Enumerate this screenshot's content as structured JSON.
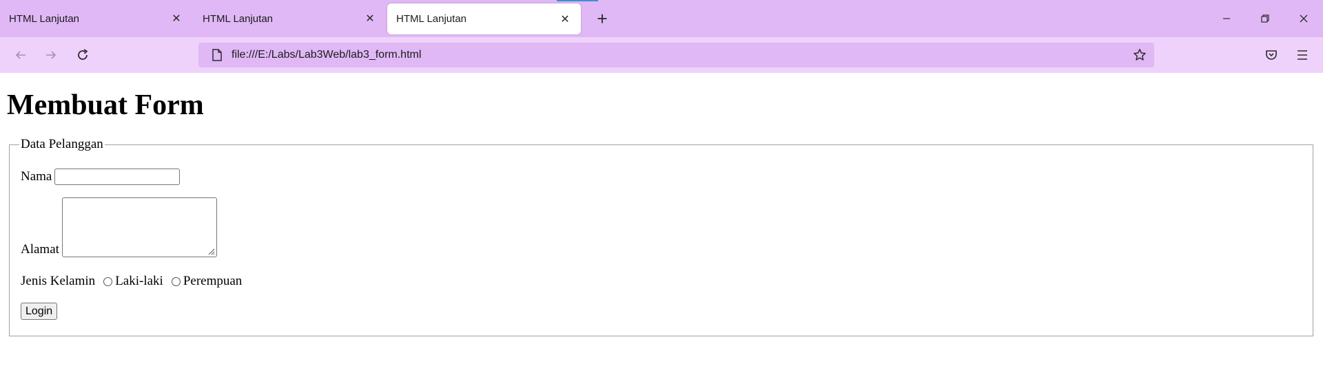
{
  "browser": {
    "tabs": [
      {
        "title": "HTML Lanjutan",
        "active": false,
        "close": "✕"
      },
      {
        "title": "HTML Lanjutan",
        "active": false,
        "close": "✕"
      },
      {
        "title": "HTML Lanjutan",
        "active": true,
        "close": "✕"
      }
    ],
    "new_tab": "+",
    "window_controls": {
      "minimize": "─",
      "restore": "❐",
      "close": "✕"
    },
    "url": "file:///E:/Labs/Lab3Web/lab3_form.html",
    "colors": {
      "tabbar": "#e0b8f5",
      "navbar": "#efd2fb",
      "urlbar": "#e0b8f5"
    }
  },
  "page": {
    "heading": "Membuat Form",
    "fieldset_legend": "Data Pelanggan",
    "nama_label": "Nama",
    "nama_value": "",
    "alamat_label": "Alamat",
    "alamat_value": "",
    "jenis_kelamin_label": "Jenis Kelamin",
    "radio_options": [
      "Laki-laki",
      "Perempuan"
    ],
    "submit_label": "Login"
  }
}
